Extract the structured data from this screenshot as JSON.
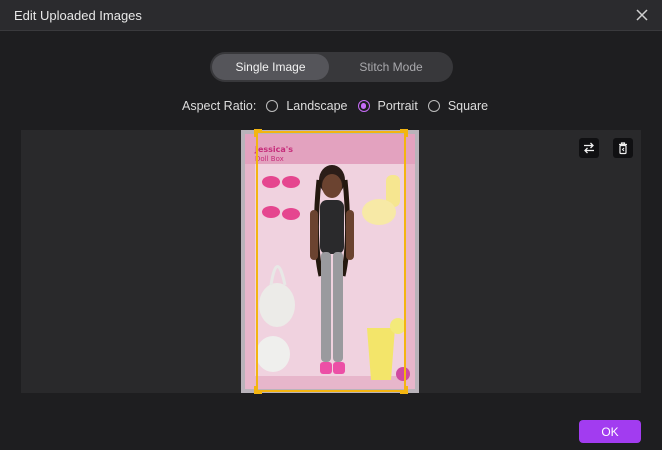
{
  "window": {
    "title": "Edit Uploaded Images"
  },
  "mode_tabs": [
    {
      "label": "Single Image",
      "active": true
    },
    {
      "label": "Stitch Mode",
      "active": false
    }
  ],
  "aspect_ratio": {
    "label": "Aspect Ratio:",
    "options": [
      "Landscape",
      "Portrait",
      "Square"
    ],
    "selected": "Portrait"
  },
  "image": {
    "description": "Packaged fashion doll with accessories",
    "box_text": "Jessica's Doll Box"
  },
  "toolbar": {
    "swap_icon": "swap-arrows-icon",
    "delete_icon": "trash-icon"
  },
  "footer": {
    "ok_label": "OK"
  },
  "colors": {
    "accent": "#a23cf0",
    "radio": "#c76cf7",
    "crop_frame": "#f3b511"
  }
}
